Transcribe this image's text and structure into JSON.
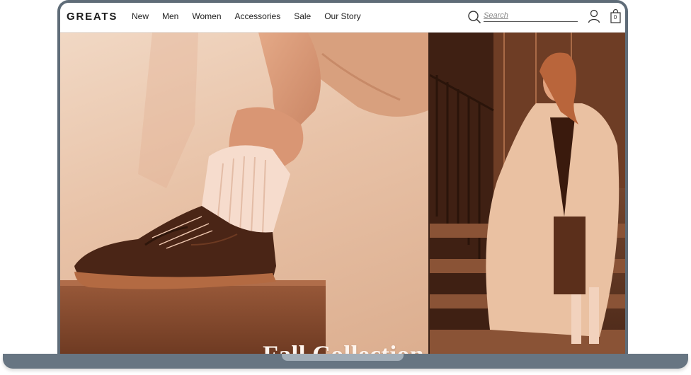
{
  "brand": {
    "logo": "GREATS"
  },
  "nav": {
    "items": [
      "New",
      "Men",
      "Women",
      "Accessories",
      "Sale",
      "Our Story"
    ]
  },
  "search": {
    "placeholder": "Search",
    "value": ""
  },
  "cart": {
    "count": "0"
  },
  "hero": {
    "headline": "Fall Collection"
  },
  "icons": {
    "search": "search-icon",
    "account": "user-icon",
    "cart": "shopping-bag-icon"
  },
  "colors": {
    "hero_tone": "#e8c2a7",
    "headline": "#fff5ee",
    "frame": "#5f6c78"
  }
}
